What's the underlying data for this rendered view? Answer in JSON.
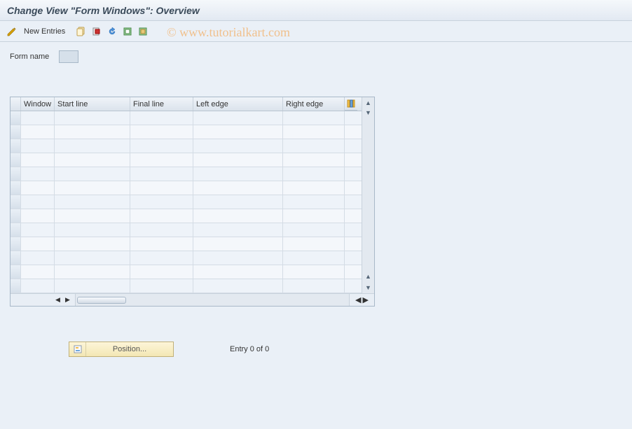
{
  "title": "Change View \"Form Windows\": Overview",
  "watermark": "© www.tutorialkart.com",
  "toolbar": {
    "new_entries_label": "New Entries"
  },
  "form": {
    "name_label": "Form name",
    "name_value": ""
  },
  "grid": {
    "columns": {
      "window": "Window",
      "start_line": "Start line",
      "final_line": "Final line",
      "left_edge": "Left edge",
      "right_edge": "Right edge"
    },
    "row_count": 13
  },
  "footer": {
    "position_label": "Position...",
    "entry_text": "Entry 0 of 0"
  }
}
